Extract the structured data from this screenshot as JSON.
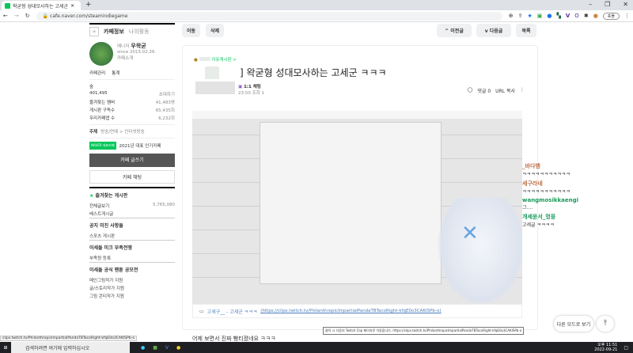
{
  "browser": {
    "tab_title": "왁굳형 성대모사하는 고세군",
    "url": "cafe.naver.com/steamindiegame",
    "profile": "포폴",
    "new_tab": "+"
  },
  "sidebar": {
    "tab_info": "카페정보",
    "tab_activity": "나의활동",
    "manager_badge": "매니저",
    "manager": "우왁굳",
    "since": "since 2015.02.26.",
    "cafe_intro": "카페소개",
    "manage": "카페관리",
    "stats": "통계",
    "level": "숲",
    "members": "401,495",
    "invite": "초대하기",
    "fav_members_label": "즐겨찾는 멤버",
    "fav_members": "41,483명",
    "board_subs_label": "게시판 구독수",
    "board_subs": "65,435회",
    "rep_label": "우리카페앱 수",
    "rep": "6,232회",
    "theme_label": "주제",
    "theme": "방송/연예 > 인터넷방송",
    "award_badge": "NAVER 대표카페",
    "award": "2021년 대표 인기카페",
    "write": "카페 글쓰기",
    "chat": "카페 채팅",
    "fav_boards": "즐겨찾는 게시판",
    "all_posts": "전체글보기",
    "all_count": "5,765,080",
    "best": "베스트게시글",
    "sec1": "공지 미진 사항들",
    "sports": "스포츠 게시판",
    "sec2": "이세돌 미크 부족전쟁",
    "tribe": "부족원 등록",
    "sec3": "이세돌 공식 팬툰 공모전",
    "m1": "메인그림작가 지원",
    "m2": "글/스토리작가 지원",
    "m3": "그림 콘티작가 지원"
  },
  "toolbar": {
    "move": "이동",
    "delete": "삭제",
    "prev": "^ 이전글",
    "next": "v 다음글",
    "list": "목록"
  },
  "article": {
    "board": "자유게시판 >",
    "title": "] 왁굳형 성대모사하는 고세군 ㅋㅋㅋ",
    "chat_tag": "1:1 채팅",
    "time": "23:50",
    "views": "조회 1",
    "comments": "댓글 0",
    "url_copy": "URL 복사",
    "link_text": "고세구__ - 고세군 ㅋㅋㅋ",
    "link_url": "(https://clips.twitch.tv/PhilanthropicImpartialPandaTBTacoRight-kfqE0o3CAKISPb-o)",
    "tooltip": "클릭 시 다음의 Twitch Clip 페이지로 이동합니다. https://clips.twitch.tv/PhilanthropicImpartialPandaTBTacoRight-kfqE0o3CAKISPb-o",
    "body": "어제 보면서 진짜 뻥티졌네요 ㅋㅋㅋ"
  },
  "chat": [
    {
      "user": "_바다뱀",
      "msg": "ㅋㅋㅋㅋㅋㅋㅋㅋㅋㅋㅋ",
      "color": "#c0704a"
    },
    {
      "user": "세구라네",
      "msg": "ㅋㅋㅋㅋㅋㅋㅋㅋㅋㅋㅋ",
      "color": "#c0704a"
    },
    {
      "user": "wangmosikkaengi",
      "msg": "그....",
      "color": "#1a9a5a"
    },
    {
      "user": "개세윤서_멍뭉",
      "msg": "고세글 ㅋㅋㅋㅋ",
      "color": "#1a9a5a"
    }
  ],
  "floating": {
    "other_posts": "다른 모드로 보기",
    "top": "⤒"
  },
  "taskbar": {
    "search": "검색하려면 여기에 입력하십시오",
    "time": "오후 11:51",
    "date": "2022-09-21"
  },
  "statusbar": "clips.twitch.tv/PhilanthropicImpartialPandaTBTacoRight-kfqE0o3CAKISPb-o"
}
